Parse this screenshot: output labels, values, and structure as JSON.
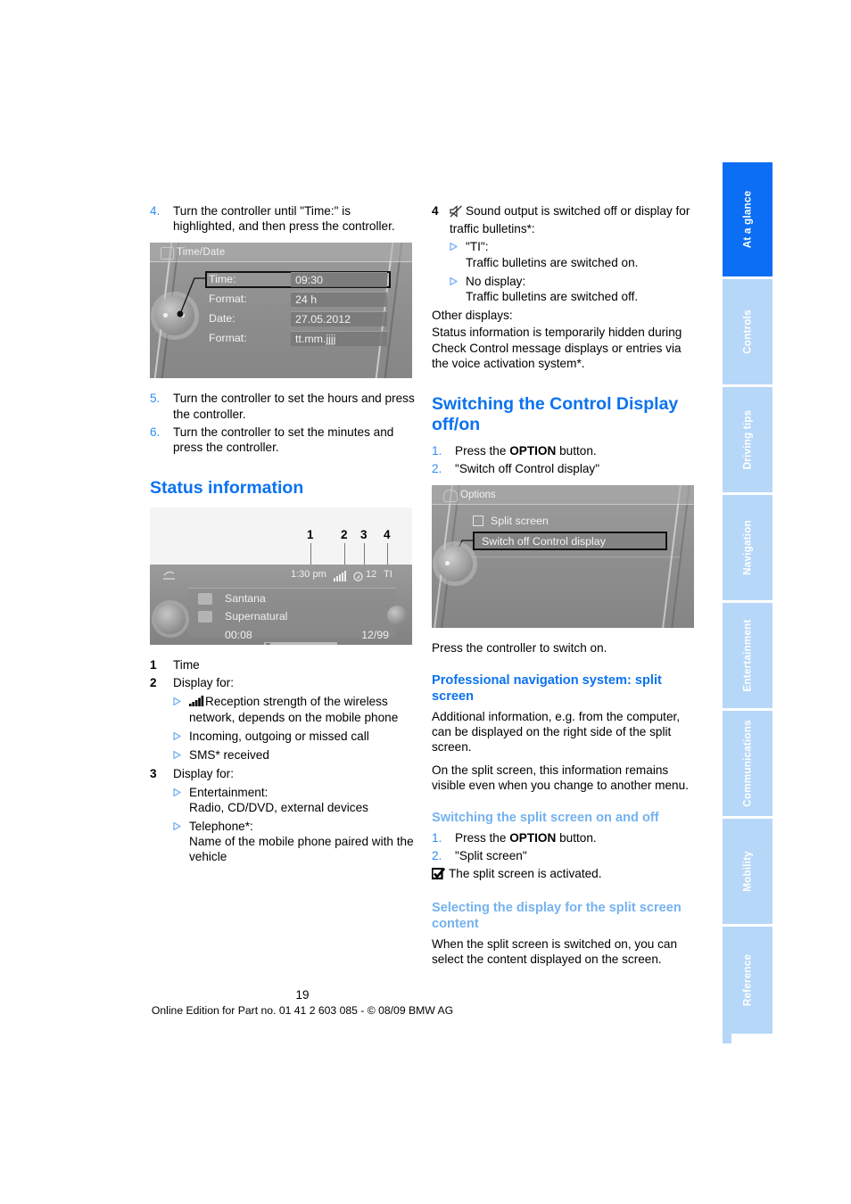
{
  "page": {
    "number": "19",
    "footer_text": "Online Edition for Part no. 01 41 2 603 085 - © 08/09 BMW AG"
  },
  "sidebar": {
    "tabs": [
      {
        "label": "At a glance",
        "active": true
      },
      {
        "label": "Controls",
        "active": false
      },
      {
        "label": "Driving tips",
        "active": false
      },
      {
        "label": "Navigation",
        "active": false
      },
      {
        "label": "Entertainment",
        "active": false
      },
      {
        "label": "Communications",
        "active": false
      },
      {
        "label": "Mobility",
        "active": false
      },
      {
        "label": "Reference",
        "active": false
      }
    ]
  },
  "left_column": {
    "step4": {
      "num": "4.",
      "text": "Turn the controller until \"Time:\" is highlighted, and then press the controller."
    },
    "timedate_figure": {
      "title": "Time/Date",
      "rows": [
        {
          "label": "Time:",
          "value": "09:30",
          "selected": true
        },
        {
          "label": "Format:",
          "value": "24 h",
          "selected": false
        },
        {
          "label": "Date:",
          "value": "27.05.2012",
          "selected": false
        },
        {
          "label": "Format:",
          "value": "tt.mm.jjjj",
          "selected": false
        }
      ]
    },
    "step5": {
      "num": "5.",
      "text": "Turn the controller to set the hours and press the controller."
    },
    "step6": {
      "num": "6.",
      "text": "Turn the controller to set the minutes and press the controller."
    },
    "status_heading": "Status information",
    "status_figure": {
      "callouts": [
        "1",
        "2",
        "3",
        "4"
      ],
      "status_bar": {
        "time": "1:30 pm",
        "temperature": "12",
        "traffic": "TI"
      },
      "panel": {
        "artist": "Santana",
        "album": "Supernatural",
        "elapsed": "00:08",
        "track": "12/99"
      }
    },
    "legend": [
      {
        "num": "1",
        "text": "Time",
        "children": []
      },
      {
        "num": "2",
        "text": "Display for:",
        "children": [
          {
            "icon": "signal-bars-icon",
            "text": "Reception strength of the wireless network, depends on the mobile phone"
          },
          {
            "icon": null,
            "text": "Incoming, outgoing or missed call"
          },
          {
            "icon": null,
            "text": "SMS* received"
          }
        ]
      },
      {
        "num": "3",
        "text": "Display for:",
        "children": [
          {
            "icon": null,
            "text": "Entertainment:\nRadio, CD/DVD, external devices"
          },
          {
            "icon": null,
            "text": "Telephone*:\nName of the mobile phone paired with the vehicle"
          }
        ]
      }
    ]
  },
  "right_column": {
    "item4": {
      "num": "4",
      "icon": "mute-speaker-icon",
      "text": "Sound output is switched off or display for traffic bulletins*:",
      "children": [
        {
          "text": "\"TI\":\nTraffic bulletins are switched on."
        },
        {
          "text": "No display:\nTraffic bulletins are switched off."
        }
      ]
    },
    "other_displays": {
      "lead": "Other displays:",
      "body": "Status information is temporarily hidden during Check Control message displays or entries via the voice activation system*."
    },
    "switching_heading": "Switching the Control Display off/on",
    "switching_steps": [
      {
        "num": "1.",
        "prefix": "Press the ",
        "bold": "OPTION",
        "suffix": " button."
      },
      {
        "num": "2.",
        "prefix": "\"Switch off Control display\"",
        "bold": "",
        "suffix": ""
      }
    ],
    "options_figure": {
      "title": "Options",
      "option1": "Split screen",
      "option2_selected": "Switch off Control display"
    },
    "press_controller": "Press the controller to switch on.",
    "prof_nav_heading": "Professional navigation system: split screen",
    "prof_nav_body1": "Additional information, e.g. from the computer, can be displayed on the right side of the split screen.",
    "prof_nav_body2": "On the split screen, this information remains visible even when you change to another menu.",
    "split_toggle_heading": "Switching the split screen on and off",
    "split_toggle_steps": [
      {
        "num": "1.",
        "prefix": "Press the ",
        "bold": "OPTION",
        "suffix": " button."
      },
      {
        "num": "2.",
        "prefix": "\"Split screen\"",
        "bold": "",
        "suffix": ""
      }
    ],
    "split_result": "The split screen is activated.",
    "select_display_heading": "Selecting the display for the split screen content",
    "select_display_body": "When the split screen is switched on, you can select the content displayed on the screen."
  },
  "colors": {
    "accent_blue": "#0b72ef",
    "light_blue": "#74b2f0",
    "tab_blue": "#b6d7f8",
    "tab_active": "#0b6ef4"
  }
}
